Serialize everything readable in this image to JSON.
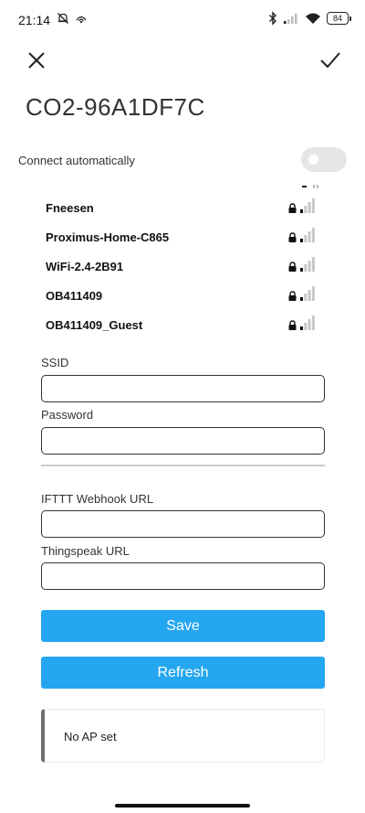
{
  "status_bar": {
    "time": "21:14",
    "battery": "84",
    "icons": [
      "bell-muted-icon",
      "hotspot-icon",
      "bluetooth-icon",
      "signal-icon",
      "wifi-icon",
      "battery-icon"
    ]
  },
  "header": {
    "close_icon": "close-icon",
    "confirm_icon": "check-icon"
  },
  "device": {
    "name": "CO2-96A1DF7C"
  },
  "connect_automatically": {
    "label": "Connect automatically",
    "enabled": false
  },
  "networks": [
    {
      "ssid": "Fneesen",
      "secured": true
    },
    {
      "ssid": "Proximus-Home-C865",
      "secured": true
    },
    {
      "ssid": "WiFi-2.4-2B91",
      "secured": true
    },
    {
      "ssid": "OB411409",
      "secured": true
    },
    {
      "ssid": "OB411409_Guest",
      "secured": true
    }
  ],
  "form": {
    "ssid_label": "SSID",
    "ssid_value": "",
    "password_label": "Password",
    "password_value": "",
    "ifttt_label": "IFTTT Webhook URL",
    "ifttt_value": "",
    "thingspeak_label": "Thingspeak URL",
    "thingspeak_value": ""
  },
  "buttons": {
    "save": "Save",
    "refresh": "Refresh"
  },
  "info": {
    "text": "No AP set"
  },
  "colors": {
    "accent": "#25a6f0",
    "info_border": "#6f6f6f"
  }
}
